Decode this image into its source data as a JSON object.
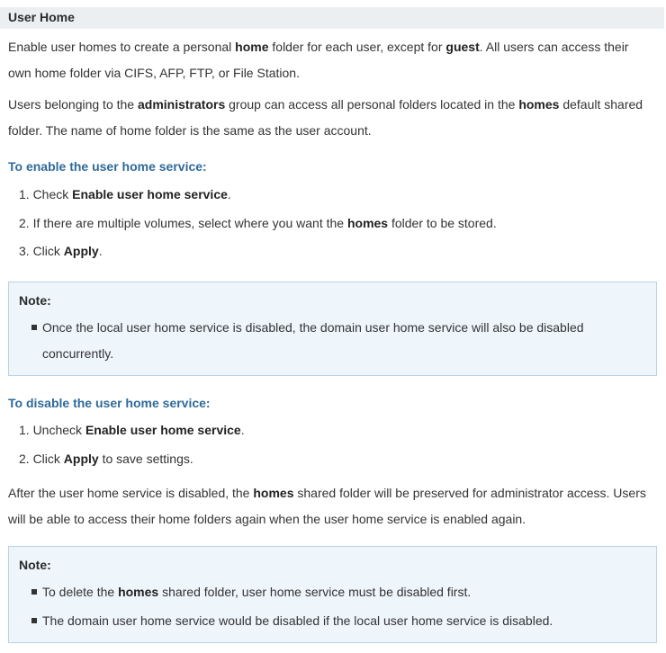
{
  "title": "User Home",
  "p1": {
    "a": "Enable user homes to create a personal ",
    "b1": "home",
    "c": " folder for each user, except for ",
    "b2": "guest",
    "d": ". All users can access their",
    "line2": "own home folder via CIFS, AFP, FTP, or File Station."
  },
  "p2": {
    "a": "Users belonging to the ",
    "b1": "administrators",
    "c": " group can access all personal folders located in the ",
    "b2": "homes",
    "d": " default shared",
    "line2": "folder. The name of home folder is the same as the user account."
  },
  "enable": {
    "heading": "To enable the user home service:",
    "step1": {
      "pre": "1. Check ",
      "bold": "Enable user home service",
      "post": "."
    },
    "step2": {
      "pre": "2. If there are multiple volumes, select where you want the ",
      "bold": "homes",
      "post": " folder to be stored."
    },
    "step3": {
      "pre": "3. Click ",
      "bold": "Apply",
      "post": "."
    }
  },
  "note1": {
    "title": "Note:",
    "line1": "Once the local user home service is disabled, the domain user home service will also be disabled",
    "line2": "concurrently."
  },
  "disable": {
    "heading": "To disable the user home service:",
    "step1": {
      "pre": "1. Uncheck ",
      "bold": "Enable user home service",
      "post": "."
    },
    "step2": {
      "pre": "2. Click ",
      "bold": "Apply",
      "post": " to save settings."
    }
  },
  "p3": {
    "a": "After the user home service is disabled, the ",
    "b1": "homes",
    "c": " shared folder will be preserved for administrator access. Users",
    "line2": "will be able to access their home folders again when the user home service is enabled again."
  },
  "note2": {
    "title": "Note:",
    "item1": {
      "pre": "To delete the ",
      "bold": "homes",
      "post": " shared folder, user home service must be disabled first."
    },
    "item2": "The domain user home service would be disabled if the local user home service is disabled."
  }
}
